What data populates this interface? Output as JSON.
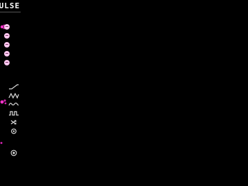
{
  "app": {
    "logo_text": "PULSE"
  },
  "colors": {
    "background": "#000000",
    "accent": "#ff33cc",
    "dot": "#ffc8f0",
    "icon": "#dddddd"
  },
  "preset_dots": [
    {
      "name": "preset-1"
    },
    {
      "name": "preset-2"
    },
    {
      "name": "preset-3"
    },
    {
      "name": "preset-4"
    },
    {
      "name": "preset-5"
    }
  ],
  "waveforms": [
    {
      "icon": "ramp-wave-icon"
    },
    {
      "icon": "sawtooth-wave-icon"
    },
    {
      "icon": "sine-wave-icon"
    },
    {
      "icon": "square-wave-icon"
    },
    {
      "icon": "shuffle-icon"
    },
    {
      "icon": "settings-icon"
    }
  ],
  "controls": {
    "record_icon": "record-icon"
  }
}
